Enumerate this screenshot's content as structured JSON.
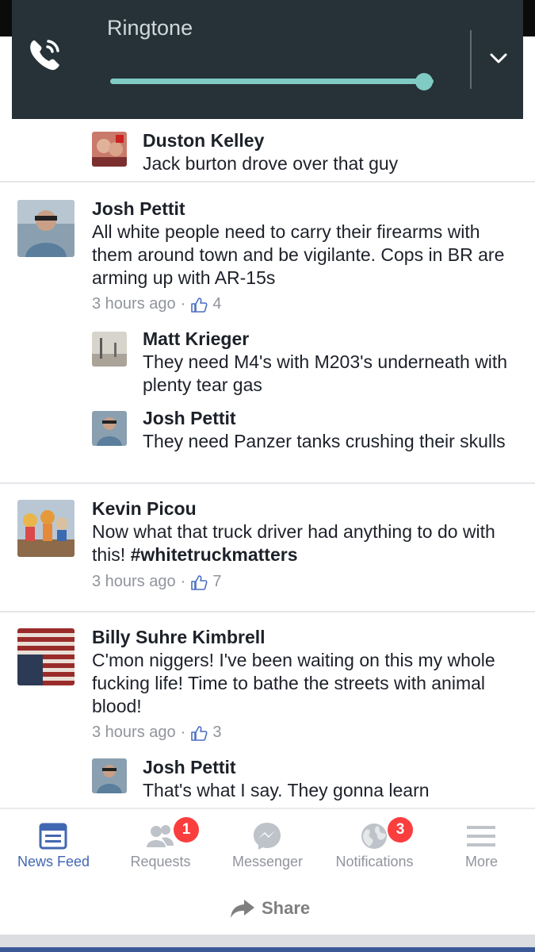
{
  "volume_panel": {
    "title": "Ringtone",
    "level_fraction": 0.97,
    "accent_color": "#80cbc4",
    "phone_icon": "phone-ringing-icon",
    "expand_icon": "chevron-down-icon"
  },
  "comments": [
    {
      "name": "Duston Kelley",
      "text": "Jack burton drove over that guy"
    },
    {
      "name": "Josh Pettit",
      "text": "All white people need to carry their firearms with them around town and be vigilante. Cops in BR are arming up with AR-15s",
      "time": "3 hours ago",
      "likes": "4",
      "replies": [
        {
          "name": "Matt Krieger",
          "text": "They need M4's with M203's underneath with plenty tear gas"
        },
        {
          "name": "Josh Pettit",
          "text": "They need Panzer tanks crushing their skulls"
        }
      ]
    },
    {
      "name": "Kevin Picou",
      "text": "Now what that truck driver had anything to do with this!",
      "hashtag": "#whitetruckmatters",
      "time": "3 hours ago",
      "likes": "7"
    },
    {
      "name": "Billy Suhre Kimbrell",
      "text": "C'mon niggers! I've been waiting on this my whole fucking life! Time to bathe the streets with animal blood!",
      "time": "3 hours ago",
      "likes": "3",
      "replies": [
        {
          "name": "Josh Pettit",
          "text": "That's what I say. They gonna learn"
        }
      ]
    }
  ],
  "separator": "·",
  "bottom_nav": [
    {
      "label": "News Feed",
      "icon": "news-feed-icon",
      "active": true
    },
    {
      "label": "Requests",
      "icon": "friend-requests-icon",
      "badge": "1"
    },
    {
      "label": "Messenger",
      "icon": "messenger-icon"
    },
    {
      "label": "Notifications",
      "icon": "globe-icon",
      "badge": "3"
    },
    {
      "label": "More",
      "icon": "menu-icon"
    }
  ],
  "share_label": "Share",
  "colors": {
    "accent": "#4267b2",
    "badge": "#fa3e3e",
    "meta": "#90949c"
  }
}
